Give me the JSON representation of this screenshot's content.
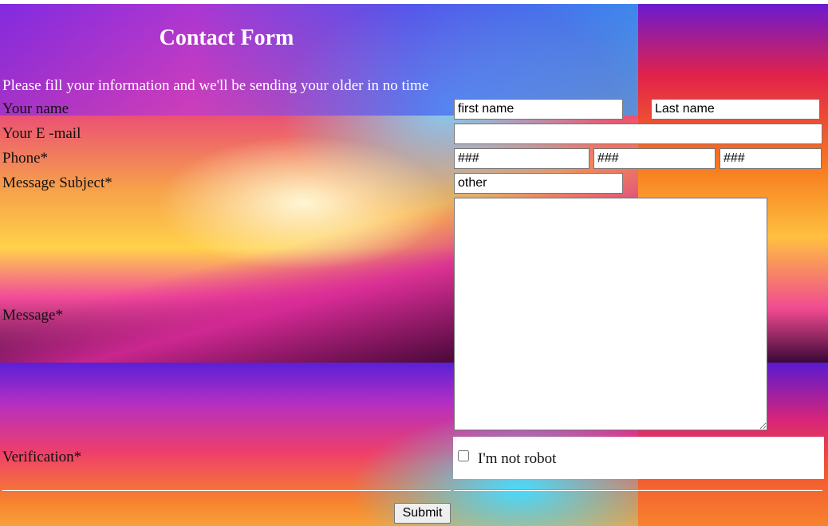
{
  "form": {
    "title": "Contact Form",
    "intro": "Please fill your information and we'll be sending your older in no time",
    "labels": {
      "name": "Your name",
      "email": "Your E -mail",
      "phone": "Phone*",
      "subject": "Message Subject*",
      "message": "Message*",
      "verification": "Verification*"
    },
    "fields": {
      "first_name_placeholder": "first name",
      "last_name_placeholder": "Last name",
      "email_value": "",
      "phone_part1_placeholder": "###",
      "phone_part2_placeholder": "###",
      "phone_part3_placeholder": "###",
      "subject_value": "other",
      "message_value": ""
    },
    "verification_checkbox_label": "I'm not robot",
    "verification_checked": false,
    "submit_label": "Submit"
  }
}
